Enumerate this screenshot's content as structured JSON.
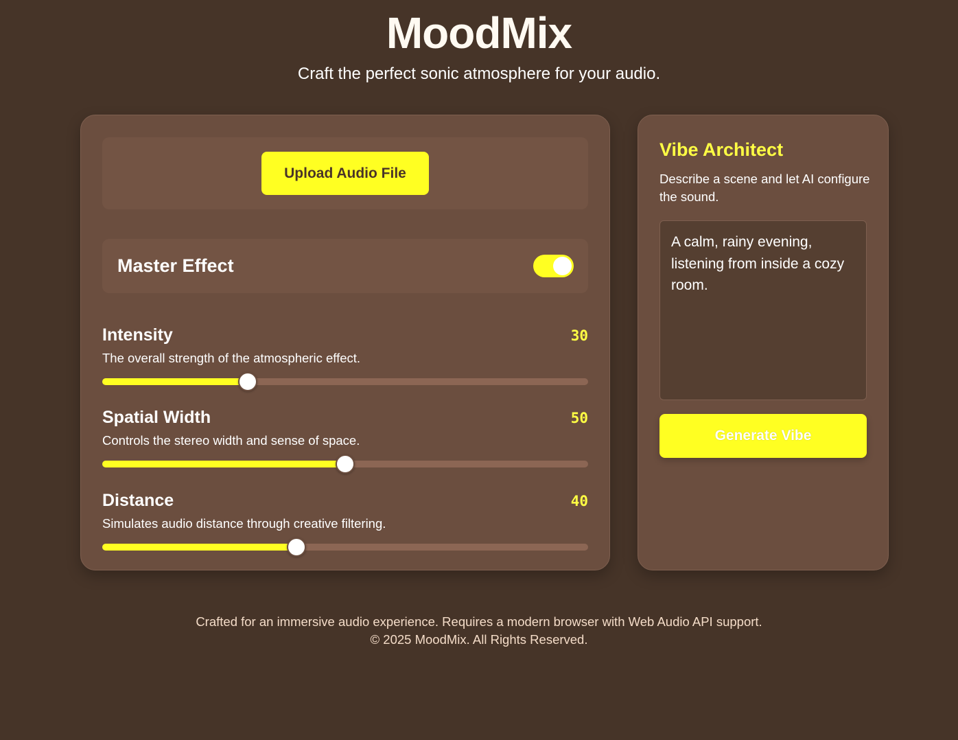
{
  "app": {
    "title": "MoodMix",
    "subtitle": "Craft the perfect sonic atmosphere for your audio."
  },
  "upload": {
    "button_label": "Upload Audio File"
  },
  "master": {
    "label": "Master Effect",
    "enabled": true
  },
  "sliders": [
    {
      "title": "Intensity",
      "value": "30",
      "description": "The overall strength of the atmospheric effect.",
      "percent": 30
    },
    {
      "title": "Spatial Width",
      "value": "50",
      "description": "Controls the stereo width and sense of space.",
      "percent": 50
    },
    {
      "title": "Distance",
      "value": "40",
      "description": "Simulates audio distance through creative filtering.",
      "percent": 40
    }
  ],
  "vibe": {
    "title": "Vibe Architect",
    "description": "Describe a scene and let AI configure the sound.",
    "input_value": "A calm, rainy evening, listening from inside a cozy room.",
    "button_label": "Generate Vibe"
  },
  "footer": {
    "line1": "Crafted for an immersive audio experience. Requires a modern browser with Web Audio API support.",
    "line2": "© 2025 MoodMix. All Rights Reserved."
  },
  "colors": {
    "background": "#463428",
    "card": "#6b4e3f",
    "accent": "#ffff22",
    "track": "#8c6654"
  }
}
